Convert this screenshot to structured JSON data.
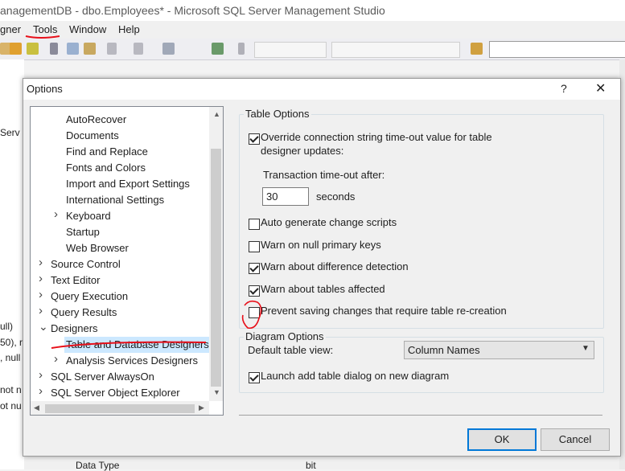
{
  "window": {
    "title": "anagementDB - dbo.Employees* - Microsoft SQL Server Management Studio"
  },
  "menubar": {
    "items": [
      "gner",
      "Tools",
      "Window",
      "Help"
    ]
  },
  "background_fragments": [
    "Serv",
    "ull)",
    "50), r",
    ", null",
    "not n",
    "ot nu",
    "Data Type",
    "bit"
  ],
  "dialog": {
    "title": "Options",
    "help_glyph": "?",
    "close_glyph": "✕",
    "tree": {
      "items": [
        {
          "label": "AutoRecover",
          "level": 2,
          "expander": ""
        },
        {
          "label": "Documents",
          "level": 2,
          "expander": ""
        },
        {
          "label": "Find and Replace",
          "level": 2,
          "expander": ""
        },
        {
          "label": "Fonts and Colors",
          "level": 2,
          "expander": ""
        },
        {
          "label": "Import and Export Settings",
          "level": 2,
          "expander": ""
        },
        {
          "label": "International Settings",
          "level": 2,
          "expander": ""
        },
        {
          "label": "Keyboard",
          "level": 2,
          "expander": "collapsed"
        },
        {
          "label": "Startup",
          "level": 2,
          "expander": ""
        },
        {
          "label": "Web Browser",
          "level": 2,
          "expander": ""
        },
        {
          "label": "Source Control",
          "level": 1,
          "expander": "collapsed"
        },
        {
          "label": "Text Editor",
          "level": 1,
          "expander": "collapsed"
        },
        {
          "label": "Query Execution",
          "level": 1,
          "expander": "collapsed"
        },
        {
          "label": "Query Results",
          "level": 1,
          "expander": "collapsed"
        },
        {
          "label": "Designers",
          "level": 1,
          "expander": "expanded"
        },
        {
          "label": "Table and Database Designers",
          "level": 2,
          "expander": "",
          "selected": true
        },
        {
          "label": "Analysis Services Designers",
          "level": 2,
          "expander": "collapsed"
        },
        {
          "label": "SQL Server AlwaysOn",
          "level": 1,
          "expander": "collapsed"
        },
        {
          "label": "SQL Server Object Explorer",
          "level": 1,
          "expander": "collapsed"
        }
      ]
    },
    "table_options": {
      "group_label": "Table Options",
      "override_timeout": {
        "label_line1": "Override connection string time-out value for table",
        "label_line2": "designer updates:",
        "checked": true
      },
      "timeout_label": "Transaction time-out after:",
      "timeout_value": "30",
      "timeout_unit": "seconds",
      "checkboxes": [
        {
          "label": "Auto generate change scripts",
          "checked": false
        },
        {
          "label": "Warn on null primary keys",
          "checked": false
        },
        {
          "label": "Warn about difference detection",
          "checked": true
        },
        {
          "label": "Warn about tables affected",
          "checked": true
        },
        {
          "label": "Prevent saving changes that require table re-creation",
          "checked": false
        }
      ]
    },
    "diagram_options": {
      "group_label": "Diagram Options",
      "default_view_label": "Default table view:",
      "default_view_value": "Column Names",
      "launch_add_table": {
        "label": "Launch add table dialog on new diagram",
        "checked": true
      }
    },
    "buttons": {
      "ok": "OK",
      "cancel": "Cancel"
    }
  },
  "colors": {
    "annotation_red": "#e8101a",
    "selection_bg": "#cce8ff",
    "focus_blue": "#0078d7"
  }
}
